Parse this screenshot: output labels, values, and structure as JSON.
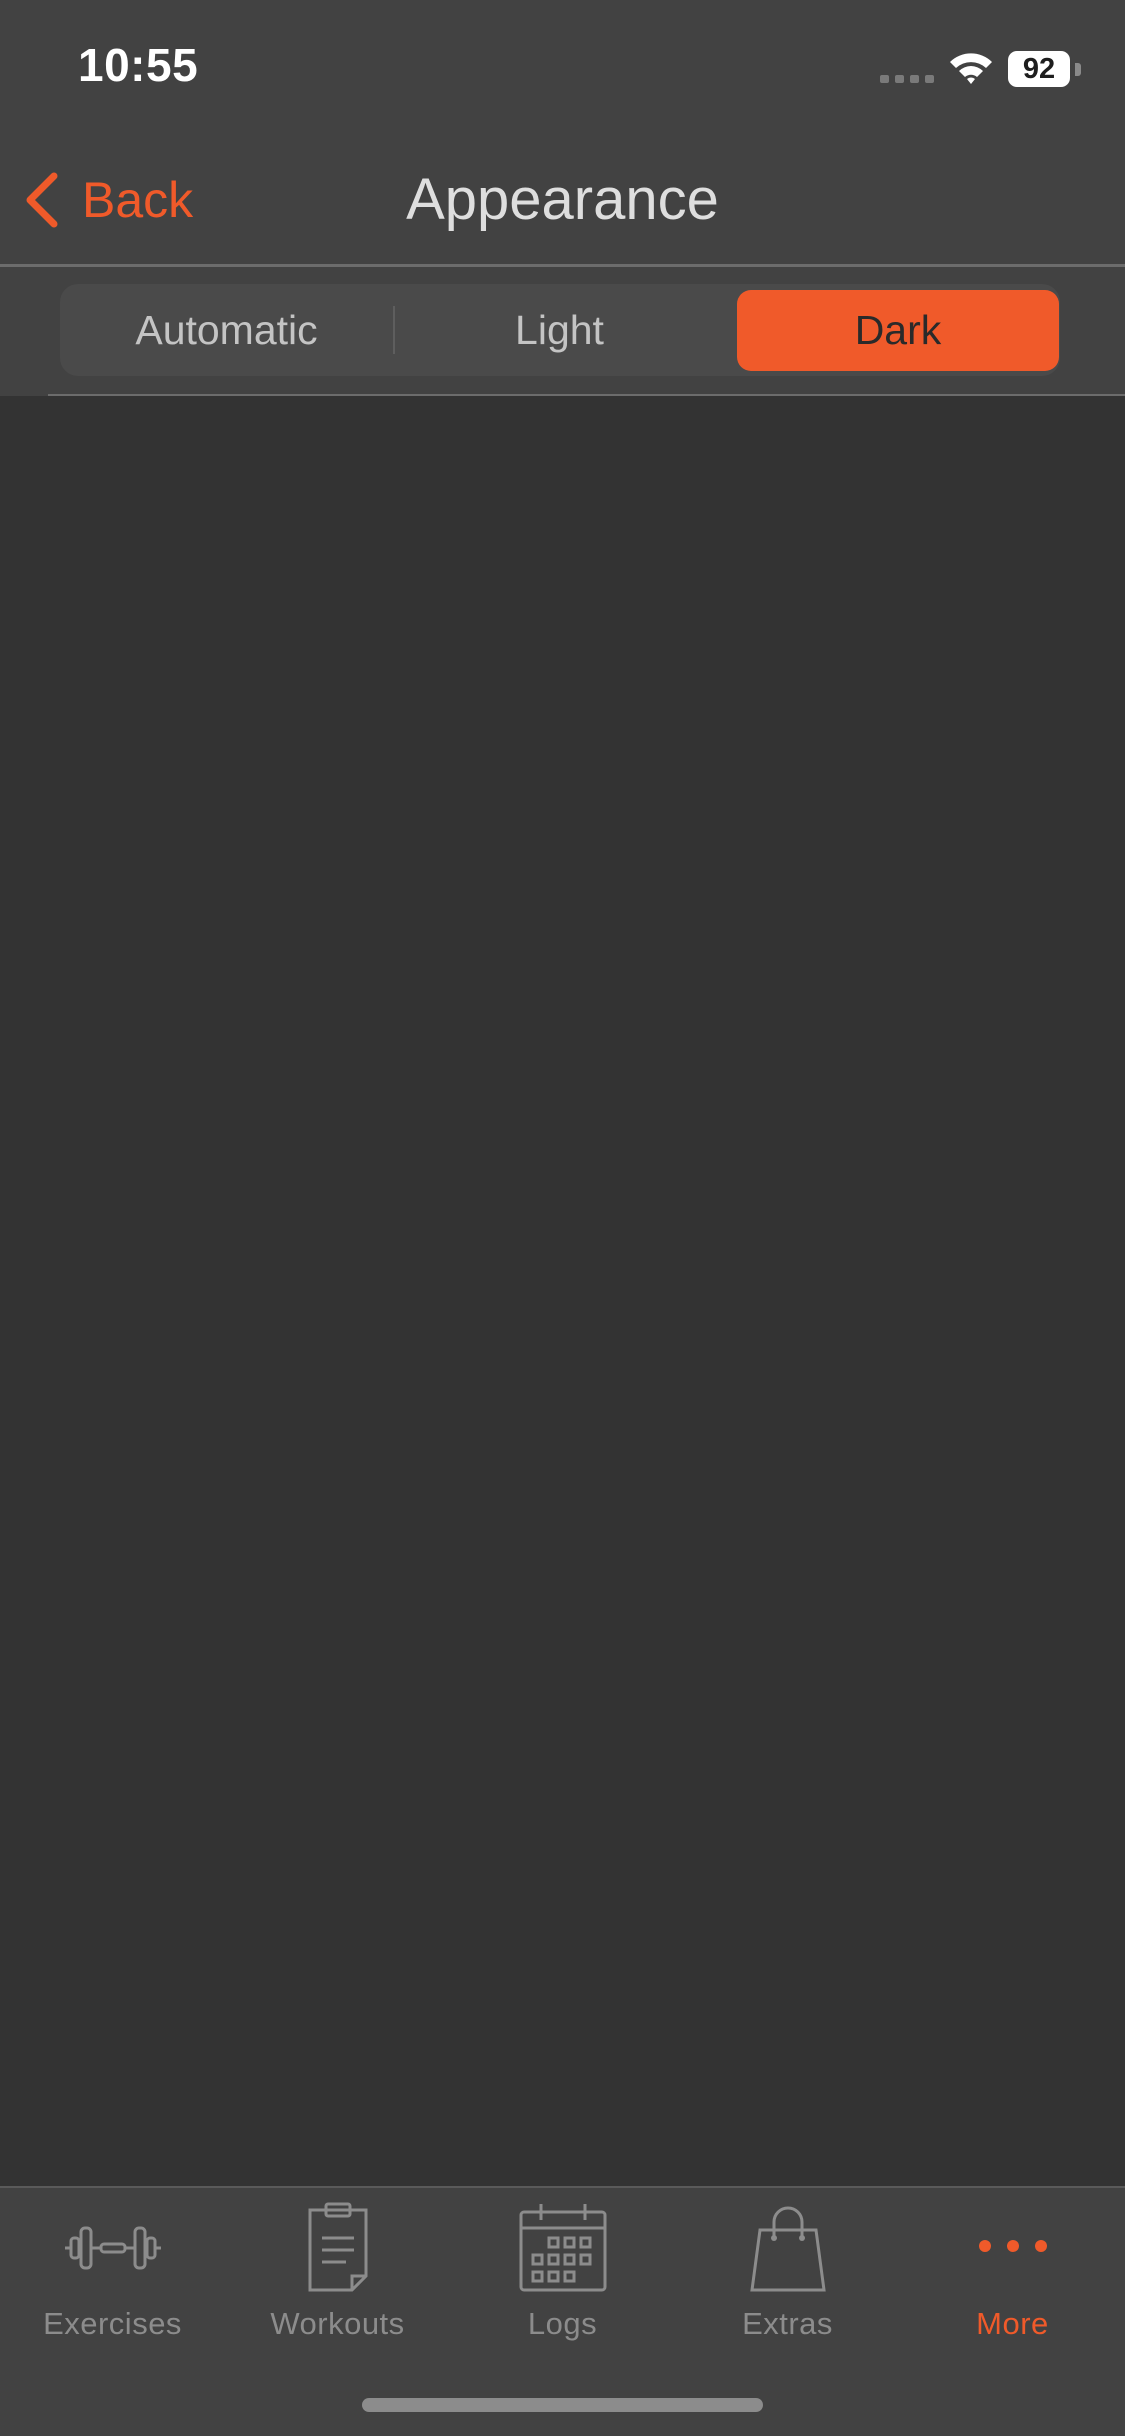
{
  "status_bar": {
    "time": "10:55",
    "battery": "92",
    "icons": [
      "cellular-signal-icon",
      "wifi-icon",
      "battery-icon"
    ]
  },
  "nav": {
    "back_label": "Back",
    "title": "Appearance"
  },
  "appearance": {
    "options": [
      {
        "label": "Automatic",
        "selected": false
      },
      {
        "label": "Light",
        "selected": false
      },
      {
        "label": "Dark",
        "selected": true
      }
    ]
  },
  "tab_bar": {
    "items": [
      {
        "label": "Exercises",
        "icon": "dumbbell-icon",
        "active": false
      },
      {
        "label": "Workouts",
        "icon": "clipboard-icon",
        "active": false
      },
      {
        "label": "Logs",
        "icon": "calendar-icon",
        "active": false
      },
      {
        "label": "Extras",
        "icon": "shopping-bag-icon",
        "active": false
      },
      {
        "label": "More",
        "icon": "more-dots-icon",
        "active": true
      }
    ]
  },
  "colors": {
    "accent": "#f05a2a",
    "background": "#333333",
    "bar_background": "#424242",
    "inactive_tab": "#8c8c8c"
  }
}
